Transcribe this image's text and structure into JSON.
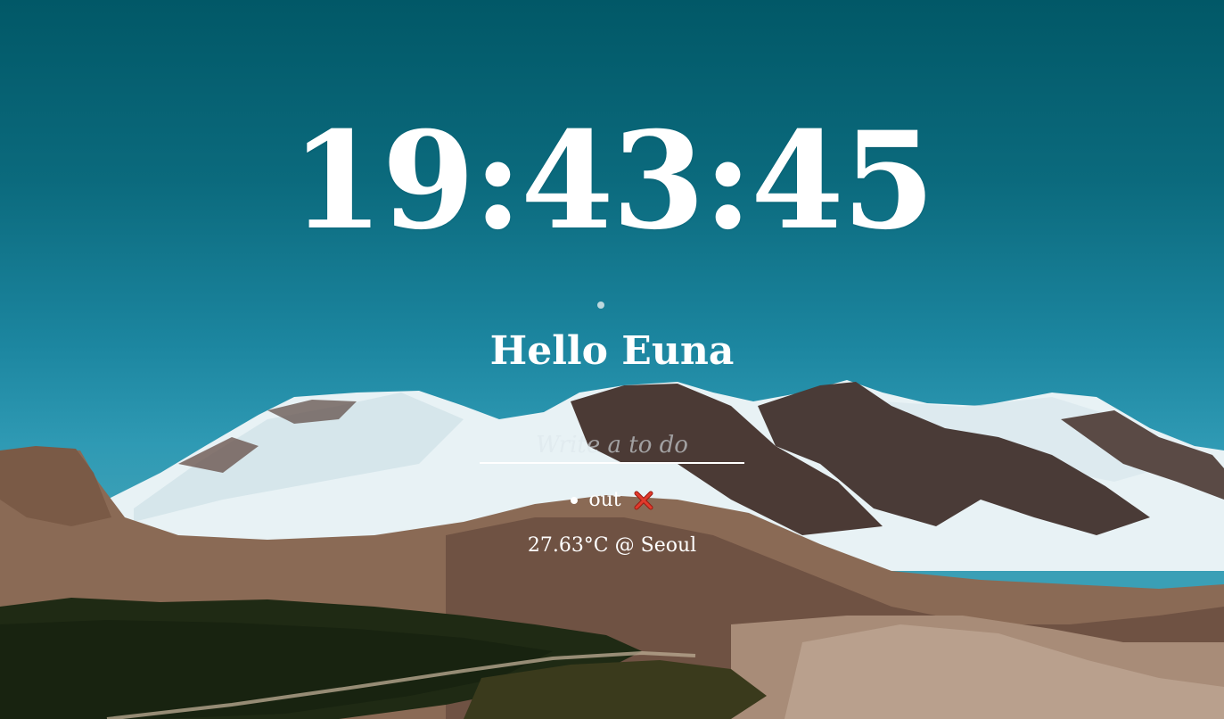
{
  "clock": {
    "time": "19:43:45"
  },
  "greeting": {
    "text": "Hello Euna"
  },
  "todo": {
    "placeholder": "Write a to do",
    "items": [
      {
        "label": "out"
      }
    ]
  },
  "weather": {
    "text": "27.63°C @ Seoul"
  },
  "colors": {
    "sky_top": "#015867",
    "sky_bottom": "#3a9fb6",
    "text": "#ffffff",
    "delete_icon": "#e23a2c"
  },
  "icons": {
    "delete": "close-x-icon",
    "bullet": "bullet-icon"
  }
}
